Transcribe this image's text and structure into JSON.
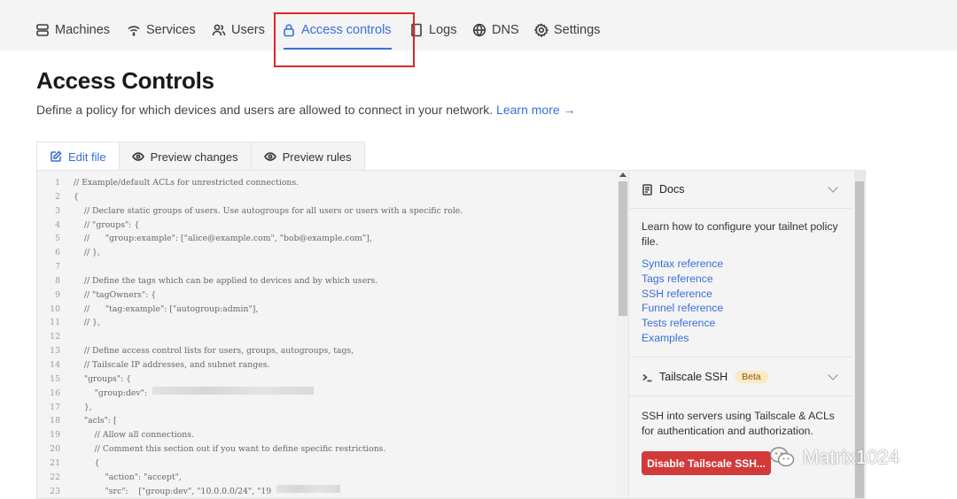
{
  "nav": {
    "items": [
      {
        "label": "Machines",
        "icon": "server-icon"
      },
      {
        "label": "Services",
        "icon": "wifi-icon"
      },
      {
        "label": "Users",
        "icon": "users-icon"
      },
      {
        "label": "Access controls",
        "icon": "lock-icon",
        "active": true
      },
      {
        "label": "Logs",
        "icon": "logs-icon"
      },
      {
        "label": "DNS",
        "icon": "globe-icon"
      },
      {
        "label": "Settings",
        "icon": "gear-icon"
      }
    ]
  },
  "page": {
    "title": "Access Controls",
    "subtitle": "Define a policy for which devices and users are allowed to connect in your network.",
    "learn_more": "Learn more →"
  },
  "tabs": [
    {
      "label": "Edit file",
      "icon": "edit-icon",
      "active": true
    },
    {
      "label": "Preview changes",
      "icon": "eye-icon"
    },
    {
      "label": "Preview rules",
      "icon": "eye-icon"
    }
  ],
  "editor": {
    "lines": [
      {
        "n": "1",
        "text": "// Example/default ACLs for unrestricted connections."
      },
      {
        "n": "2",
        "text": "{"
      },
      {
        "n": "3",
        "text": "    // Declare static groups of users. Use autogroups for all users or users with a specific role."
      },
      {
        "n": "4",
        "text": "    // \"groups\": {"
      },
      {
        "n": "5",
        "text": "    //      \"group:example\": [\"alice@example.com\", \"bob@example.com\"],"
      },
      {
        "n": "6",
        "text": "    // },"
      },
      {
        "n": "7",
        "text": ""
      },
      {
        "n": "8",
        "text": "    // Define the tags which can be applied to devices and by which users."
      },
      {
        "n": "9",
        "text": "    // \"tagOwners\": {"
      },
      {
        "n": "10",
        "text": "    //      \"tag:example\": [\"autogroup:admin\"],"
      },
      {
        "n": "11",
        "text": "    // },"
      },
      {
        "n": "12",
        "text": ""
      },
      {
        "n": "13",
        "text": "    // Define access control lists for users, groups, autogroups, tags,"
      },
      {
        "n": "14",
        "text": "    // Tailscale IP addresses, and subnet ranges."
      },
      {
        "n": "15",
        "text": "    \"groups\": {"
      },
      {
        "n": "16",
        "text": "        \"group:dev\":"
      },
      {
        "n": "17",
        "text": "    },"
      },
      {
        "n": "18",
        "text": "    \"acls\": ["
      },
      {
        "n": "19",
        "text": "        // Allow all connections."
      },
      {
        "n": "20",
        "text": "        // Comment this section out if you want to define specific restrictions."
      },
      {
        "n": "21",
        "text": "        {"
      },
      {
        "n": "22",
        "text": "            \"action\": \"accept\","
      },
      {
        "n": "23",
        "text": "            \"src\":    [\"group:dev\", \"10.0.0.0/24\", \"19"
      }
    ]
  },
  "docs": {
    "title": "Docs",
    "icon": "doc-icon",
    "description": "Learn how to configure your tailnet policy file.",
    "links": [
      "Syntax reference",
      "Tags reference",
      "SSH reference",
      "Funnel reference",
      "Tests reference",
      "Examples"
    ]
  },
  "ssh": {
    "title": "Tailscale SSH",
    "badge": "Beta",
    "icon": "terminal-icon",
    "description": "SSH into servers using Tailscale & ACLs for authentication and authorization.",
    "button": "Disable Tailscale SSH..."
  },
  "watermark": {
    "text": "Matrix1024",
    "icon": "wechat-icon"
  },
  "colors": {
    "accent": "#3a6fd8",
    "danger": "#d23a3a",
    "highlight": "#e0232a"
  }
}
